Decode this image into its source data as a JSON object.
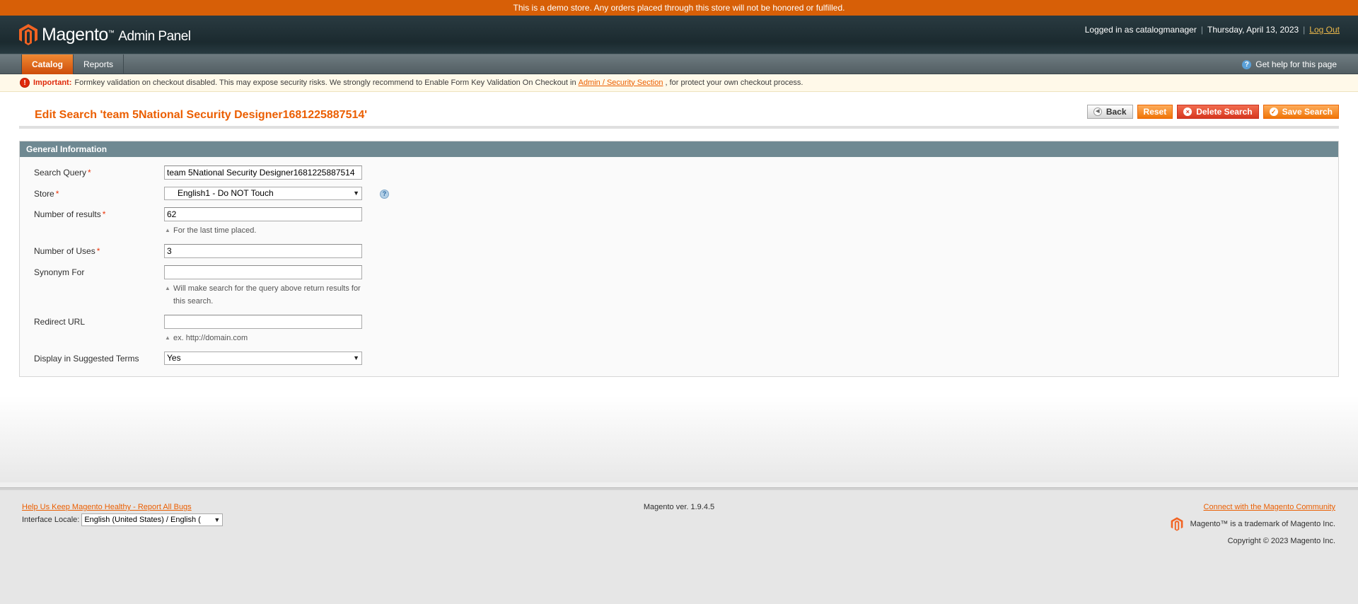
{
  "demo_notice": "This is a demo store. Any orders placed through this store will not be honored or fulfilled.",
  "header": {
    "logo_text": "Magento",
    "logo_tm": "™",
    "logo_sub": "Admin Panel",
    "logged_in_as": "Logged in as catalogmanager",
    "date": "Thursday, April 13, 2023",
    "logout": "Log Out"
  },
  "nav": {
    "items": [
      {
        "label": "Catalog",
        "active": true
      },
      {
        "label": "Reports",
        "active": false
      }
    ],
    "help": "Get help for this page"
  },
  "message": {
    "strong": "Important:",
    "text_before": "Formkey validation on checkout disabled. This may expose security risks. We strongly recommend to Enable Form Key Validation On Checkout in",
    "link": "Admin / Security Section",
    "text_after": ", for protect your own checkout process."
  },
  "page": {
    "title": "Edit Search 'team 5National Security Designer1681225887514'",
    "buttons": {
      "back": "Back",
      "reset": "Reset",
      "delete": "Delete Search",
      "save": "Save Search"
    }
  },
  "form": {
    "legend": "General Information",
    "search_query": {
      "label": "Search Query",
      "required": "*",
      "value": "team 5National Security Designer1681225887514"
    },
    "store": {
      "label": "Store",
      "required": "*",
      "value": "English1 - Do NOT Touch"
    },
    "num_results": {
      "label": "Number of results",
      "required": "*",
      "value": "62",
      "note": "For the last time placed."
    },
    "num_uses": {
      "label": "Number of Uses",
      "required": "*",
      "value": "3"
    },
    "synonym": {
      "label": "Synonym For",
      "value": "",
      "note_line1": "Will make search for the query above return results for",
      "note_line2": "this search."
    },
    "redirect": {
      "label": "Redirect URL",
      "value": "",
      "note": "ex. http://domain.com"
    },
    "suggested": {
      "label": "Display in Suggested Terms",
      "value": "Yes"
    }
  },
  "footer": {
    "bugs_link": "Help Us Keep Magento Healthy - Report All Bugs",
    "locale_label": "Interface Locale:",
    "locale_value": "English (United States) / English (",
    "version": "Magento ver. 1.9.4.5",
    "community_link": "Connect with the Magento Community",
    "trademark": "Magento™ is a trademark of Magento Inc.",
    "copyright": "Copyright © 2023 Magento Inc."
  },
  "colors": {
    "accent": "#eb5e00",
    "demo_bar": "#d75f07",
    "header_bg": "#1b2a2f",
    "legend_bg": "#6f8992"
  }
}
